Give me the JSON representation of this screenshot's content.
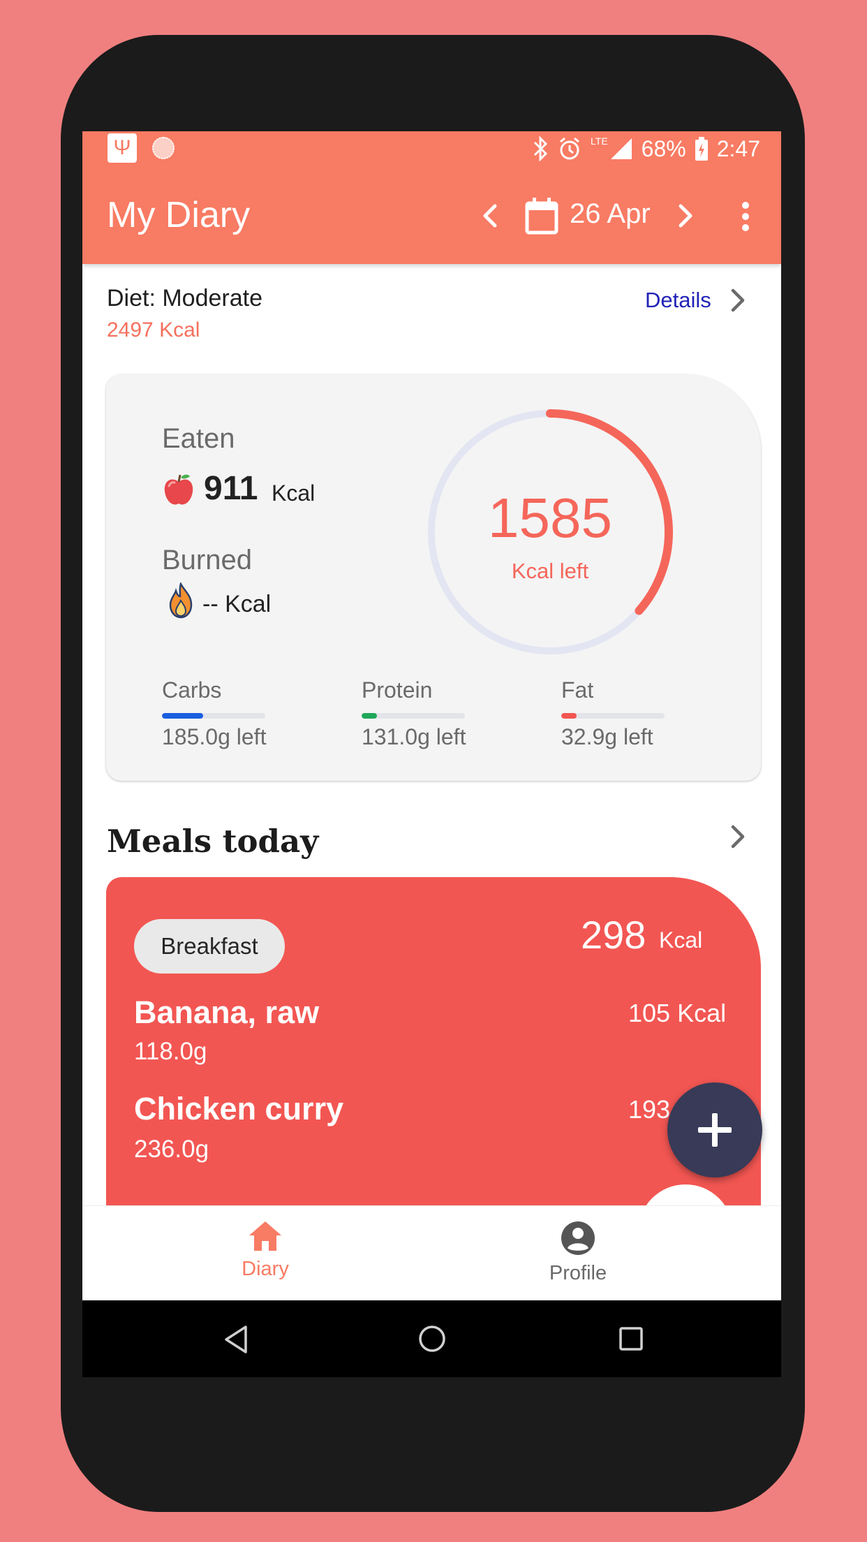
{
  "colors": {
    "background": "#f08080",
    "app_bar": "#f87b63",
    "accent": "#f5665a",
    "meal_card": "#f25652",
    "fab": "#383a57",
    "link": "#2323b8"
  },
  "status_bar": {
    "battery": "68%",
    "time": "2:47",
    "network": "LTE",
    "icons": [
      "usb-icon",
      "sync-icon",
      "bluetooth-icon",
      "alarm-icon",
      "signal-icon",
      "battery-charging-icon"
    ]
  },
  "app_bar": {
    "title": "My Diary",
    "date": "26 Apr",
    "icons": [
      "chevron-left-icon",
      "calendar-icon",
      "chevron-right-icon",
      "more-vert-icon"
    ]
  },
  "diet": {
    "label": "Diet: Moderate",
    "kcal": "2497 Kcal",
    "details_label": "Details"
  },
  "summary": {
    "eaten_label": "Eaten",
    "eaten_value": "911",
    "eaten_unit": "Kcal",
    "burned_label": "Burned",
    "burned_value": "-- Kcal",
    "kcal_left_value": "1585",
    "kcal_left_label": "Kcal left",
    "ring_progress_fraction": 0.365,
    "macros": [
      {
        "name": "Carbs",
        "left": "185.0g left",
        "progress_fraction": 0.4,
        "color": "#1a5fe0"
      },
      {
        "name": "Protein",
        "left": "131.0g left",
        "progress_fraction": 0.15,
        "color": "#1fa85a"
      },
      {
        "name": "Fat",
        "left": "32.9g left",
        "progress_fraction": 0.15,
        "color": "#f25652"
      }
    ]
  },
  "meals": {
    "title": "Meals today",
    "card": {
      "meal": "Breakfast",
      "kcal_value": "298",
      "kcal_unit": "Kcal",
      "foods": [
        {
          "name": "Banana, raw",
          "amount": "118.0g",
          "kcal": "105 Kcal"
        },
        {
          "name": "Chicken curry",
          "amount": "236.0g",
          "kcal": "193 Kcal"
        }
      ]
    }
  },
  "bottom_nav": {
    "items": [
      {
        "label": "Diary",
        "icon": "home-icon",
        "active": true
      },
      {
        "label": "Profile",
        "icon": "account-circle-icon",
        "active": false
      }
    ]
  },
  "system_nav": [
    "back-icon",
    "home-circle-icon",
    "recents-icon"
  ]
}
